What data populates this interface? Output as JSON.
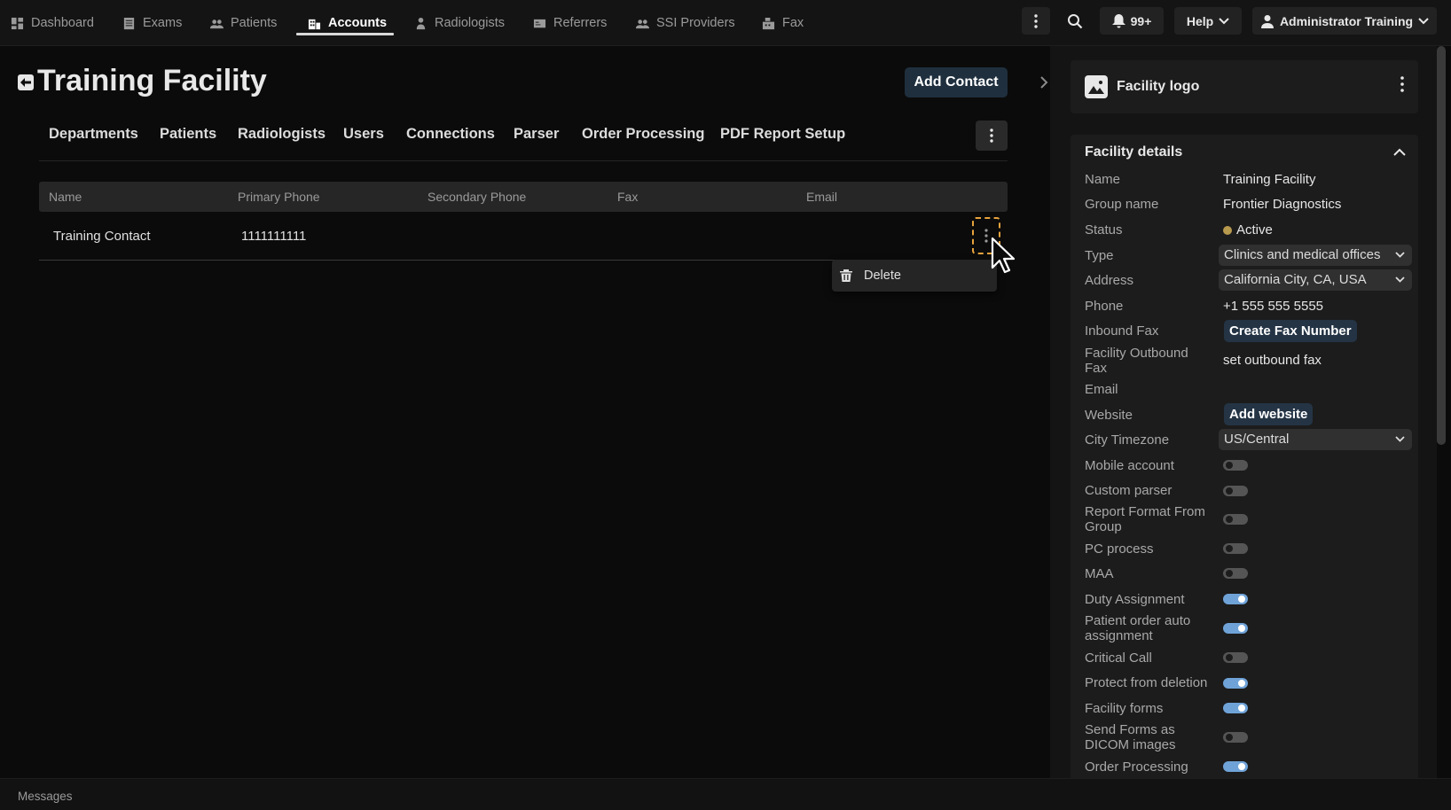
{
  "nav": {
    "items": [
      {
        "label": "Dashboard",
        "icon": "dashboard-icon"
      },
      {
        "label": "Exams",
        "icon": "exams-icon"
      },
      {
        "label": "Patients",
        "icon": "patients-icon"
      },
      {
        "label": "Accounts",
        "icon": "accounts-icon",
        "active": true
      },
      {
        "label": "Radiologists",
        "icon": "radiologist-icon"
      },
      {
        "label": "Referrers",
        "icon": "referrers-icon"
      },
      {
        "label": "SSI Providers",
        "icon": "providers-icon"
      },
      {
        "label": "Fax",
        "icon": "fax-icon"
      }
    ],
    "notifications": "99+",
    "help_label": "Help",
    "user_label": "Administrator Training"
  },
  "page": {
    "title": "Training Facility",
    "add_contact_label": "Add Contact"
  },
  "subtabs": [
    "Departments",
    "Patients",
    "Radiologists",
    "Users",
    "Connections",
    "Parser",
    "Order Processing",
    "PDF Report Setup"
  ],
  "table": {
    "columns": [
      "Name",
      "Primary Phone",
      "Secondary Phone",
      "Fax",
      "Email"
    ],
    "rows": [
      {
        "name": "Training Contact",
        "primary_phone": "1111111111",
        "secondary_phone": "",
        "fax": "",
        "email": ""
      }
    ]
  },
  "context_menu": {
    "delete_label": "Delete"
  },
  "right_panel": {
    "logo_title": "Facility logo",
    "details_title": "Facility details",
    "fields": {
      "name_label": "Name",
      "name_value": "Training Facility",
      "group_label": "Group name",
      "group_value": "Frontier Diagnostics",
      "status_label": "Status",
      "status_value": "Active",
      "type_label": "Type",
      "type_value": "Clinics and medical offices",
      "address_label": "Address",
      "address_value": "California City, CA, USA",
      "phone_label": "Phone",
      "phone_value": "+1 555 555 5555",
      "inbound_fax_label": "Inbound Fax",
      "inbound_fax_button": "Create Fax Number",
      "outbound_fax_label": "Facility Outbound Fax",
      "outbound_fax_value": "set outbound fax",
      "email_label": "Email",
      "website_label": "Website",
      "website_button": "Add website",
      "timezone_label": "City Timezone",
      "timezone_value": "US/Central"
    },
    "toggles": [
      {
        "label": "Mobile account",
        "on": false
      },
      {
        "label": "Custom parser",
        "on": false
      },
      {
        "label": "Report Format From Group",
        "on": false
      },
      {
        "label": "PC process",
        "on": false
      },
      {
        "label": "MAA",
        "on": false
      },
      {
        "label": "Duty Assignment",
        "on": true
      },
      {
        "label": "Patient order auto assignment",
        "on": true
      },
      {
        "label": "Critical Call",
        "on": false
      },
      {
        "label": "Protect from deletion",
        "on": true
      },
      {
        "label": "Facility forms",
        "on": true
      },
      {
        "label": "Send Forms as DICOM images",
        "on": false
      },
      {
        "label": "Order Processing",
        "on": true
      }
    ]
  },
  "bottom": {
    "messages_label": "Messages"
  },
  "colors": {
    "accent": "#6fa3d8",
    "focus": "#e8a33c",
    "status": "#b89a4e"
  }
}
